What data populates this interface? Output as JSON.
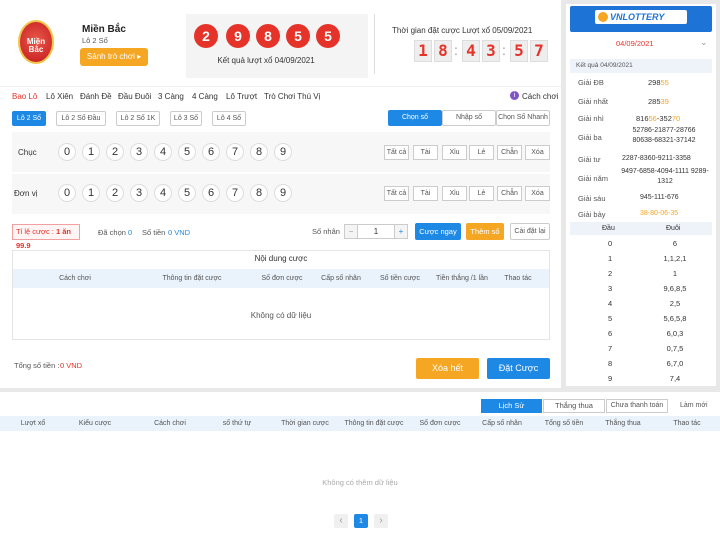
{
  "header": {
    "region": "Miền Bắc",
    "game": "Lô 2 Số",
    "logo_text": "Miền Bắc",
    "play_button": "Sảnh trò chơi ▸",
    "result_balls": [
      "2",
      "9",
      "8",
      "5",
      "5"
    ],
    "result_label": "Kết quả lượt xổ 04/09/2021",
    "countdown_label": "Thời gian đặt cược Lượt xổ 05/09/2021",
    "countdown_digits": [
      "1",
      "8",
      "4",
      "3",
      "5",
      "7"
    ]
  },
  "tabs": {
    "items": [
      "Bao Lô",
      "Lô Xiên",
      "Đánh Đề",
      "Đầu Đuôi",
      "3 Càng",
      "4 Càng",
      "Lô Trượt",
      "Trò Chơi Thú Vị"
    ],
    "howto": "Cách chơi"
  },
  "subtabs": [
    "Lô 2 Số",
    "Lô 2 Số Đầu",
    "Lô 2 Số 1K",
    "Lô 3 Số",
    "Lô 4 Số"
  ],
  "mode_buttons": [
    "Chọn số",
    "Nhập số",
    "Chọn Số Nhanh"
  ],
  "chuc": {
    "label": "Chục",
    "numbers": [
      "0",
      "1",
      "2",
      "3",
      "4",
      "5",
      "6",
      "7",
      "8",
      "9"
    ],
    "filters": [
      "Tất cả",
      "Tài",
      "Xỉu",
      "Lẻ",
      "Chẵn",
      "Xóa"
    ]
  },
  "donvi": {
    "label": "Đơn vị",
    "numbers": [
      "0",
      "1",
      "2",
      "3",
      "4",
      "5",
      "6",
      "7",
      "8",
      "9"
    ],
    "filters": [
      "Tất cả",
      "Tài",
      "Xỉu",
      "Lẻ",
      "Chẵn",
      "Xóa"
    ]
  },
  "bet": {
    "rate_label": "Tỉ lệ cược :",
    "rate_value": "1 ăn 99.9",
    "chosen_label": "Đã chọn",
    "chosen_value": "0",
    "money_label": "Số tiền",
    "money_value": "0 VND",
    "multiplier_label": "Số nhân",
    "multiplier_value": "1",
    "minus": "−",
    "plus": "+",
    "bet_now": "Cược ngay",
    "add_number": "Thêm số",
    "reset": "Cài đặt lại"
  },
  "content_table": {
    "title": "Nội dung cược",
    "headers": [
      "Cách chơi",
      "Thông tin đặt cược",
      "Số đơn cược",
      "Cấp số nhân",
      "Số tiền cược",
      "Tiền thắng /1 lần",
      "Thao tác"
    ],
    "empty": "Không có dữ liệu"
  },
  "footer": {
    "total_label": "Tổng số tiền :",
    "total_value": "0 VND",
    "clear": "Xóa hết",
    "place_bet": "Đặt Cược"
  },
  "results_panel": {
    "brand": "VNLOTTERY",
    "date": "04/09/2021",
    "subtitle": "Kết quả 04/09/2021",
    "prizes": [
      {
        "label": "Giải ĐB",
        "pre": "298",
        "post": "55"
      },
      {
        "label": "Giải nhất",
        "pre": "285",
        "post": "39"
      },
      {
        "label": "Giải nhì",
        "pre": "816",
        "post": "56",
        "sep": "-",
        "pre2": "352",
        "post2": "70"
      },
      {
        "label": "Giải ba",
        "text": "52786-21877-28766 80638-68321-37142"
      },
      {
        "label": "Giải tư",
        "text": "2287-8360-9211-3358"
      },
      {
        "label": "Giải năm",
        "text": "9497-6858-4094-1111 9289-1312"
      },
      {
        "label": "Giải sáu",
        "text": "945-111-676"
      },
      {
        "label": "Giải bảy",
        "text": "38-80-06-35"
      }
    ],
    "headdau": "Đầu",
    "headduoi": "Đuôi",
    "rows": [
      {
        "dau": "0",
        "duoi": "6"
      },
      {
        "dau": "1",
        "duoi": "1,1,2,1"
      },
      {
        "dau": "2",
        "duoi": "1"
      },
      {
        "dau": "3",
        "duoi": "9,6,8,5"
      },
      {
        "dau": "4",
        "duoi": "2,5"
      },
      {
        "dau": "5",
        "duoi": "5,6,5,8"
      },
      {
        "dau": "6",
        "duoi": "6,0,3"
      },
      {
        "dau": "7",
        "duoi": "0,7,5"
      },
      {
        "dau": "8",
        "duoi": "6,7,0"
      },
      {
        "dau": "9",
        "duoi": "7,4"
      }
    ]
  },
  "history": {
    "tabs": [
      "Lịch Sử",
      "Thắng thua",
      "Chưa thanh toán"
    ],
    "refresh": "Làm mới",
    "headers": [
      "Lượt xổ",
      "Kiểu cược",
      "Cách chơi",
      "số thứ tự",
      "Thời gian cược",
      "Thông tin đặt cược",
      "Số đơn cược",
      "Cấp số nhân",
      "Tổng số tiền",
      "Thắng thua",
      "Thao tác"
    ],
    "empty": "Không có thêm dữ liệu",
    "page": "1",
    "prev": "‹",
    "next": "›"
  },
  "colors": {
    "accent": "#1e88e5",
    "brand_red": "#e6332a",
    "orange": "#f5a623"
  }
}
